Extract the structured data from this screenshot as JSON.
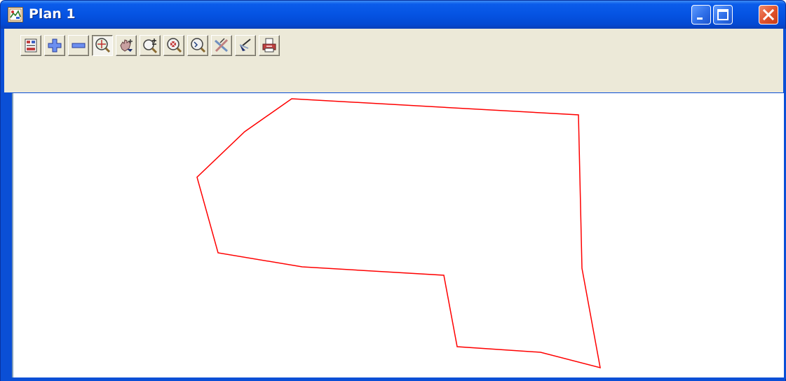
{
  "window": {
    "title": "Plan 1",
    "controls": [
      "minimize-icon",
      "maximize-icon",
      "close-icon"
    ]
  },
  "toolbar": {
    "buttons": [
      {
        "name": "plot-settings-button",
        "icon": "plot-settings-icon"
      },
      {
        "name": "zoom-in-button",
        "icon": "plus-icon"
      },
      {
        "name": "zoom-out-button",
        "icon": "minus-icon"
      },
      {
        "name": "zoom-extents-button",
        "icon": "magnifier-crosshair-icon",
        "pressed": true
      },
      {
        "name": "pan-button",
        "icon": "hand-icon"
      },
      {
        "name": "zoom-plus-minus-button",
        "icon": "magnifier-plus-minus-icon"
      },
      {
        "name": "zoom-window-button",
        "icon": "magnifier-target-icon"
      },
      {
        "name": "zoom-previous-button",
        "icon": "magnifier-icon"
      },
      {
        "name": "clip-button",
        "icon": "crossed-pencils-icon"
      },
      {
        "name": "pick-button",
        "icon": "pen-pick-icon"
      },
      {
        "name": "print-button",
        "icon": "printer-icon"
      }
    ]
  },
  "drawing": {
    "stroke_color": "#ff0000",
    "shape": "closed-polygon",
    "vertex_count": 12
  },
  "colors": {
    "title_bar": "#0553e2",
    "close_button": "#e0512b",
    "toolbar_background": "#ece9d8",
    "canvas_background": "#ffffff"
  }
}
